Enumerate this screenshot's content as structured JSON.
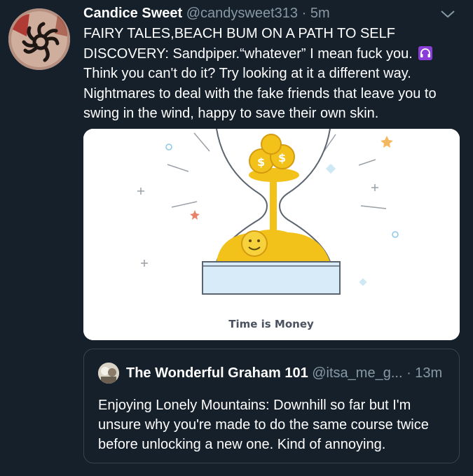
{
  "tweet": {
    "author_name": "Candice Sweet",
    "author_handle": "@candysweet313",
    "separator": "·",
    "time": "5m",
    "text_part1": "FAIRY TALES,BEACH BUM ON A PATH TO SELF DISCOVERY: Sandpiper.“whatever” I mean fuck you.",
    "emoji_icon": "headphones-icon",
    "text_part2": "Think you can't do it? Try looking at it a different way. Nightmares to deal with the fake friends that leave you to swing in the wind, happy to save their own skin.",
    "media_caption": "Time is Money"
  },
  "quote": {
    "author_name": "The Wonderful Graham 101",
    "author_handle": "@itsa_me_g...",
    "separator": "·",
    "time": "13m",
    "text": "Enjoying Lonely Mountains: Downhill so far but I'm unsure why you're made to do the same course twice before unlocking a new one. Kind of annoying."
  },
  "colors": {
    "background": "#15202b",
    "secondary_text": "#8899a6",
    "border": "#38444d",
    "coin_gold": "#f2c21a",
    "emoji_purple": "#8b3dd8"
  }
}
